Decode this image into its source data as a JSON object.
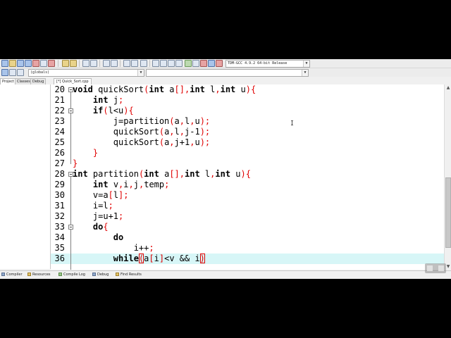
{
  "toolbar": {
    "compiler_select": "TDM-GCC 4.9.2 64-bit Release",
    "scope_select": "(globals)",
    "members_select": ""
  },
  "left_panel": {
    "tabs": [
      "Project",
      "Classes",
      "Debug"
    ]
  },
  "editor": {
    "tab_label": "[*] Quick_Sort.cpp",
    "lines": [
      {
        "n": "20",
        "text": "void quickSort(int a[],int l,int u){"
      },
      {
        "n": "21",
        "text": "    int j;"
      },
      {
        "n": "22",
        "text": "    if(l<u){"
      },
      {
        "n": "23",
        "text": "        j=partition(a,l,u);"
      },
      {
        "n": "24",
        "text": "        quickSort(a,l,j-1);"
      },
      {
        "n": "25",
        "text": "        quickSort(a,j+1,u);"
      },
      {
        "n": "26",
        "text": "    }"
      },
      {
        "n": "27",
        "text": "}"
      },
      {
        "n": "28",
        "text": "int partition(int a[],int l,int u){"
      },
      {
        "n": "29",
        "text": "    int v,i,j,temp;"
      },
      {
        "n": "30",
        "text": "    v=a[l];"
      },
      {
        "n": "31",
        "text": "    i=l;"
      },
      {
        "n": "32",
        "text": "    j=u+1;"
      },
      {
        "n": "33",
        "text": "    do{"
      },
      {
        "n": "34",
        "text": "        do"
      },
      {
        "n": "35",
        "text": "            i++;"
      },
      {
        "n": "36",
        "text": "        while(a[i]<v && i)"
      }
    ],
    "current_line": "36"
  },
  "bottom_tabs": [
    "Compiler",
    "Resources",
    "Compile Log",
    "Debug",
    "Find Results"
  ]
}
